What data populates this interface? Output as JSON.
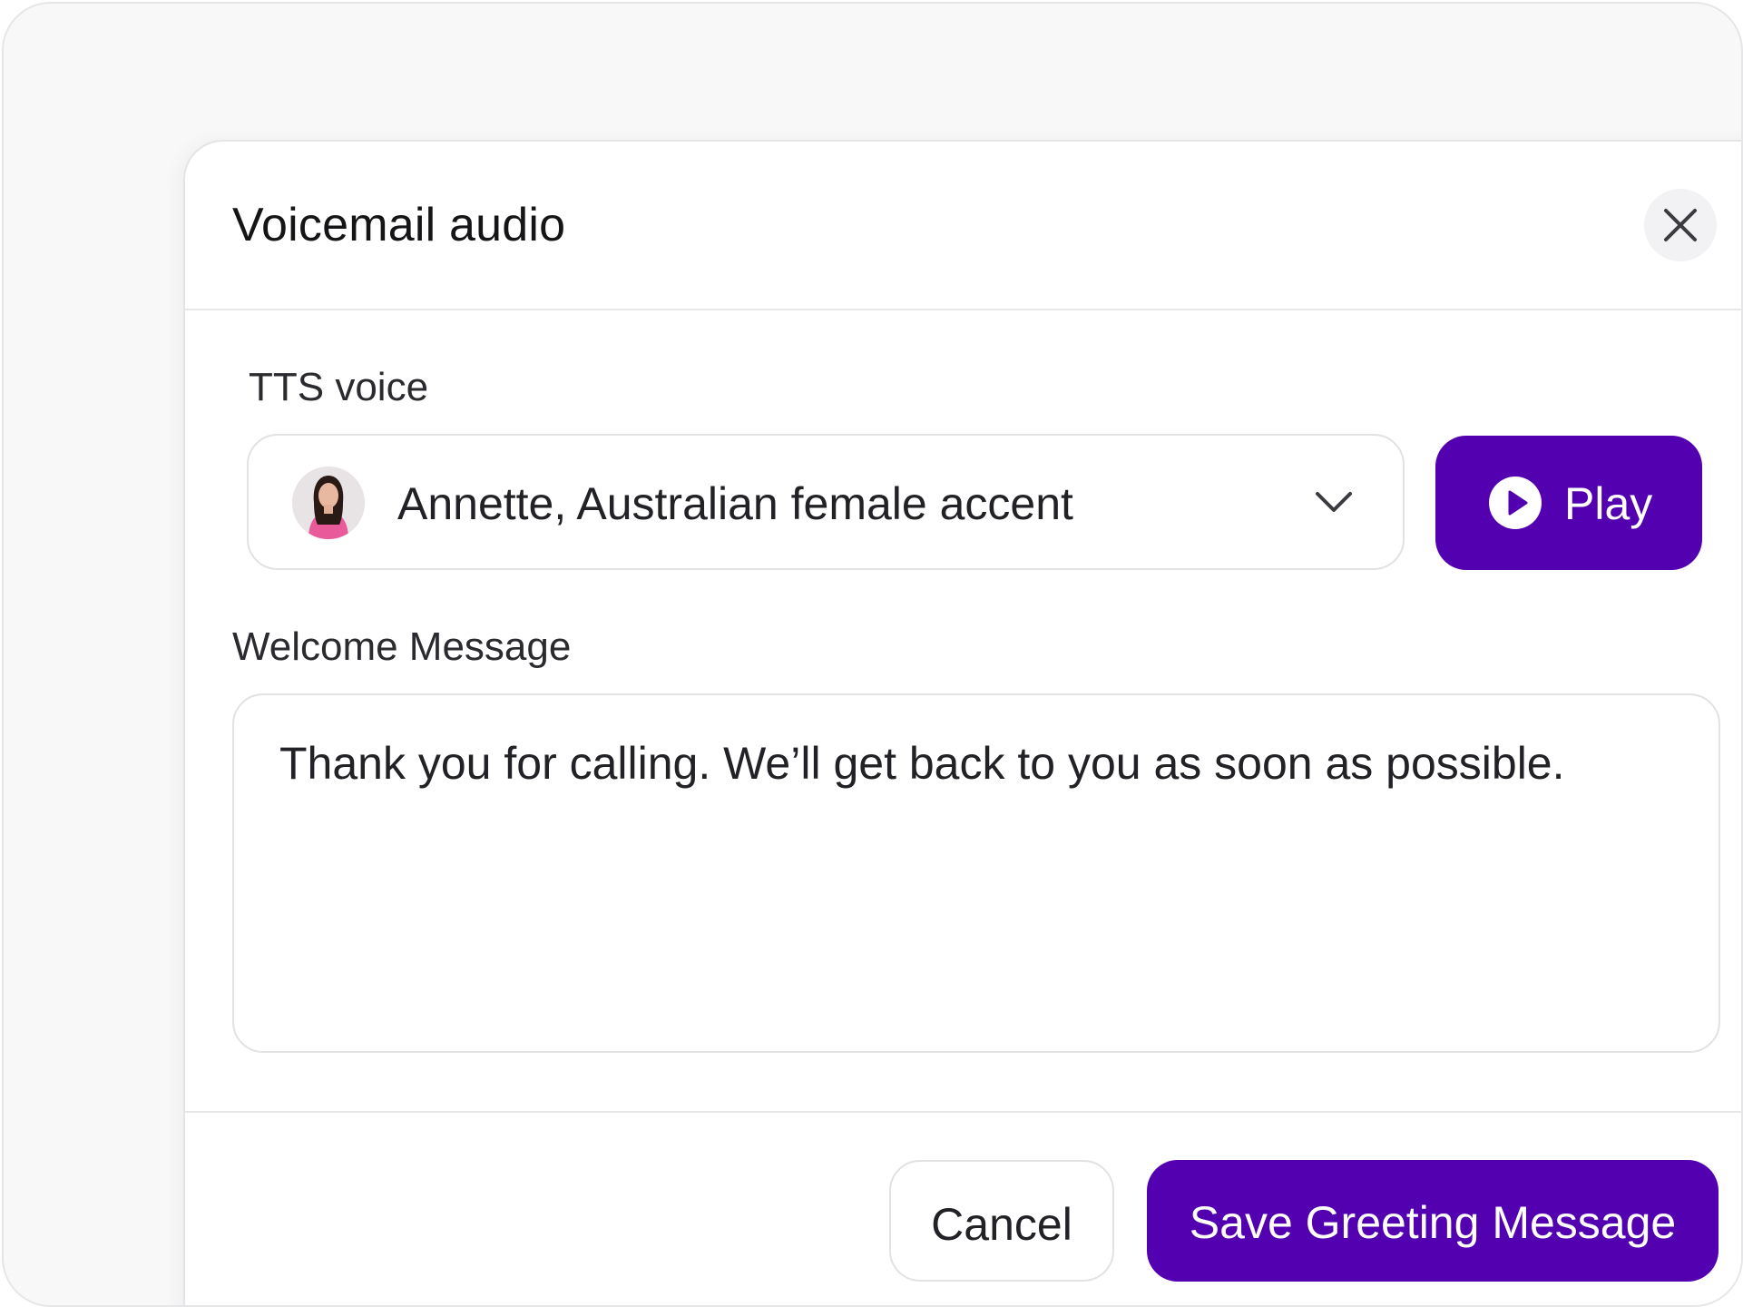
{
  "dialog": {
    "title": "Voicemail audio",
    "close_icon": "close-icon"
  },
  "tts": {
    "label": "TTS voice",
    "selected_voice": "Annette, Australian female accent",
    "avatar": "voice-avatar",
    "dropdown_icon": "chevron-down-icon"
  },
  "play": {
    "label": "Play",
    "icon": "play-circle-icon"
  },
  "welcome": {
    "label": "Welcome Message",
    "value": "Thank you for calling. We’ll get back to you as soon as possible."
  },
  "footer": {
    "cancel_label": "Cancel",
    "save_label": "Save Greeting Message"
  },
  "colors": {
    "primary": "#5300b1",
    "border": "#e2e2e5",
    "background": "#f8f8f9"
  }
}
